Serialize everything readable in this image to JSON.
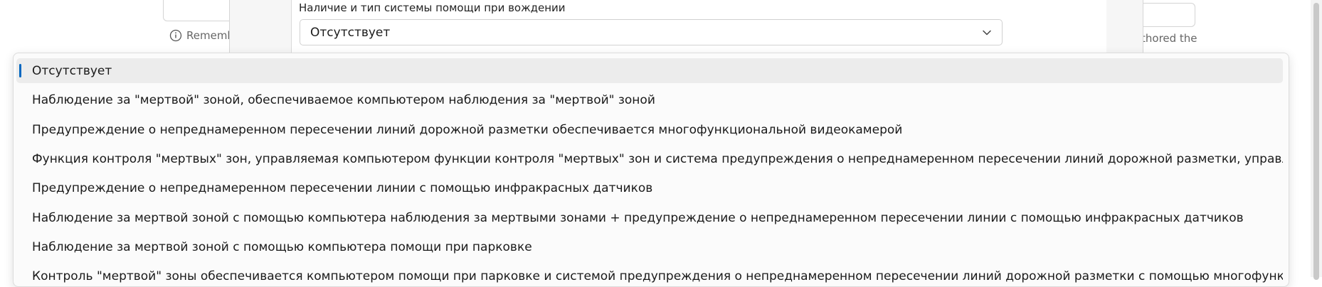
{
  "background": {
    "hint_left": "Rememb",
    "hint_right": "thored the"
  },
  "modal": {
    "field_label": "Наличие и тип системы помощи при вождении",
    "selected_value": "Отсутствует"
  },
  "dropdown": {
    "accent_color": "#0067c0",
    "selected_index": 0,
    "options": [
      "Отсутствует",
      "Наблюдение за \"мертвой\" зоной, обеспечиваемое компьютером наблюдения за \"мертвой\" зоной",
      "Предупреждение о непреднамеренном пересечении линий дорожной разметки обеспечивается многофункциональной видеокамерой",
      "Функция контроля \"мертвых\" зон, управляемая компьютером функции контроля \"мертвых\" зон и система предупреждения о непреднамеренном пересечении линий дорожной разметки, управляемая многофункциона",
      "Предупреждение о непреднамеренном пересечении линии с помощью инфракрасных датчиков",
      "Наблюдение за мертвой зоной с помощью компьютера наблюдения за мертвыми зонами + предупреждение о непреднамеренном пересечении линии с помощью инфракрасных датчиков",
      "Наблюдение за мертвой зоной с помощью компьютера помощи при парковке",
      "Контроль \"мертвой\" зоны обеспечивается компьютером помощи при парковке и системой предупреждения о непреднамеренном пересечении линий дорожной разметки с помощью многофункциональной видеокам"
    ]
  }
}
